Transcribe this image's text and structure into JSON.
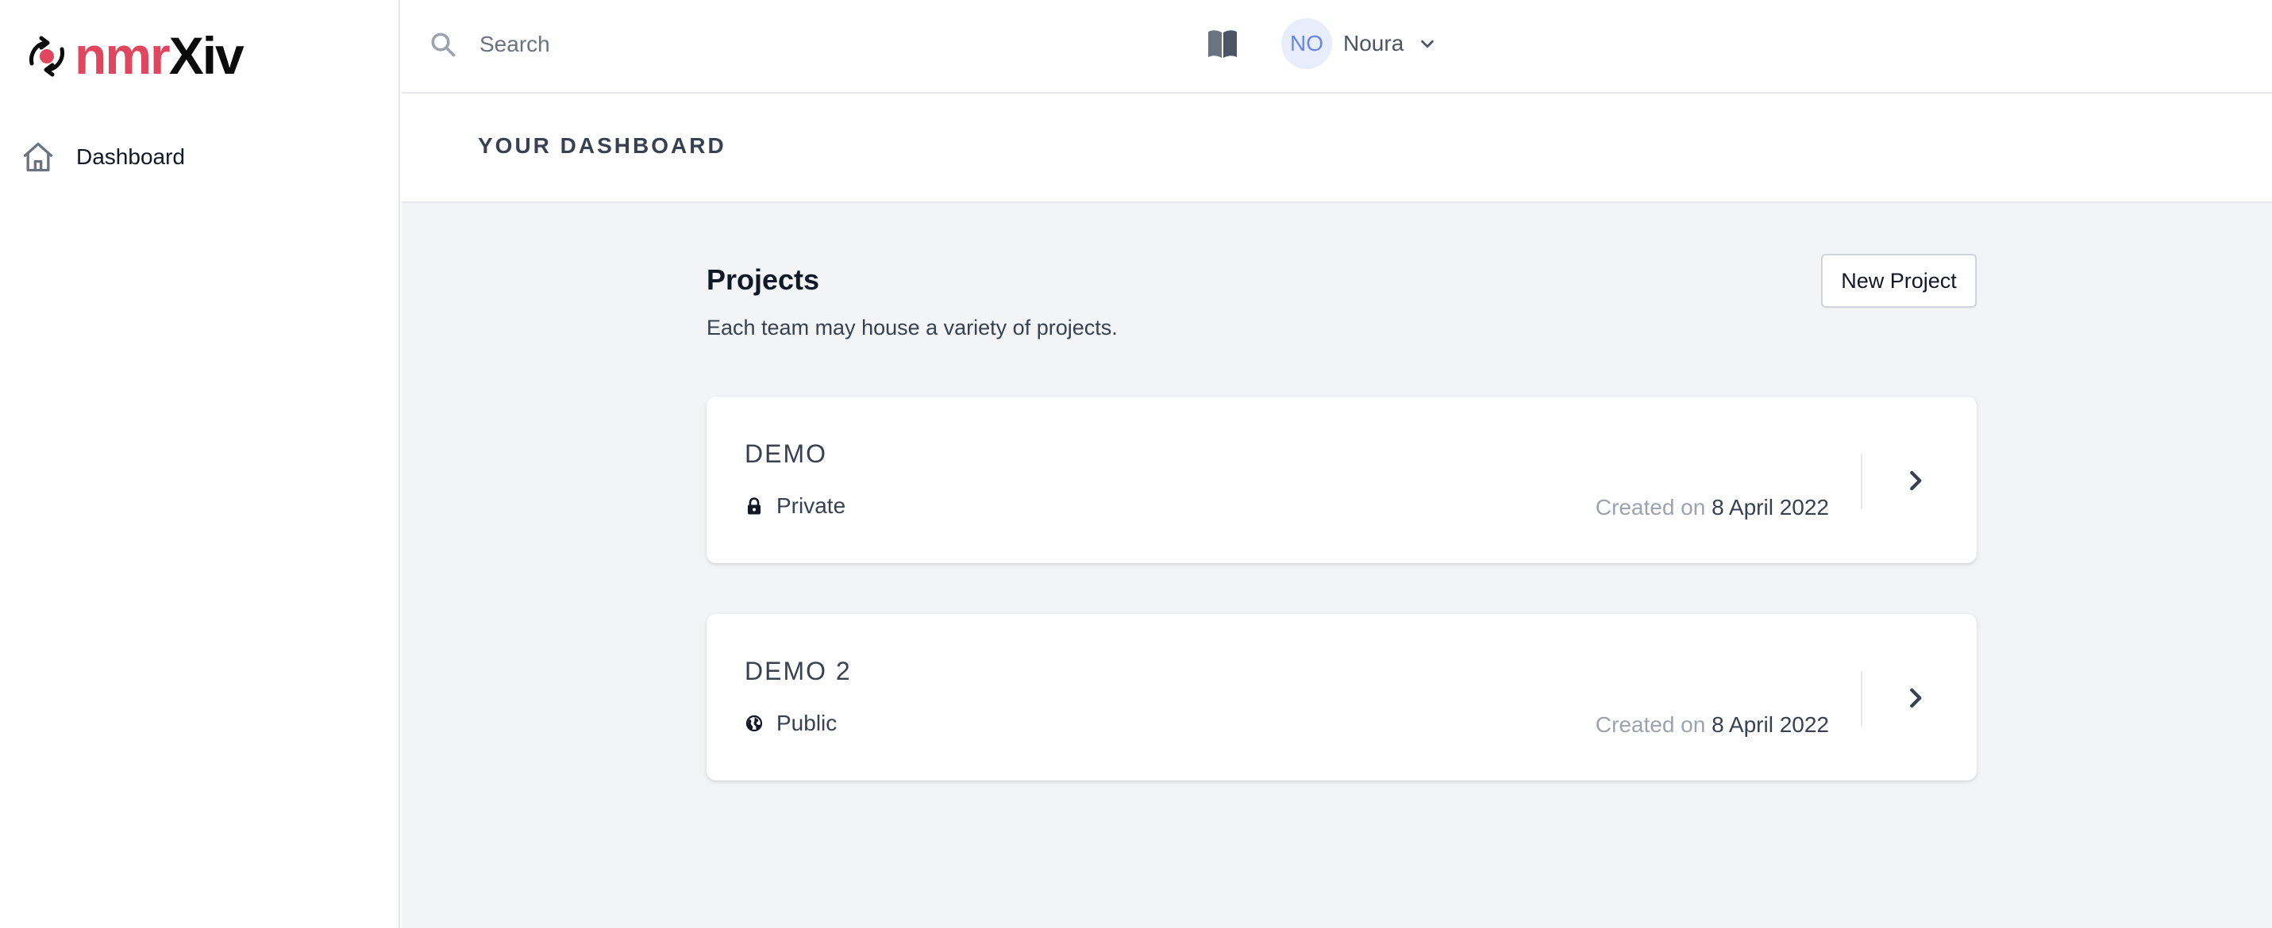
{
  "app": {
    "logo_text_part1": "nmr",
    "logo_text_part2": "Xiv"
  },
  "sidebar": {
    "items": [
      {
        "label": "Dashboard",
        "icon": "home-icon"
      }
    ]
  },
  "topbar": {
    "search_placeholder": "Search",
    "docs_icon": "book-icon",
    "user": {
      "initials": "NO",
      "name": "Noura"
    }
  },
  "page": {
    "title": "YOUR DASHBOARD"
  },
  "projects": {
    "title": "Projects",
    "description": "Each team may house a variety of projects.",
    "new_button": "New Project",
    "items": [
      {
        "name": "DEMO",
        "visibility": "Private",
        "visibility_icon": "lock-icon",
        "created_prefix": "Created on",
        "created_date": "8 April 2022"
      },
      {
        "name": "DEMO 2",
        "visibility": "Public",
        "visibility_icon": "globe-icon",
        "created_prefix": "Created on",
        "created_date": "8 April 2022"
      }
    ]
  },
  "colors": {
    "brand": "#e0465e",
    "avatar_bg": "#e8edfb",
    "avatar_text": "#6a86e8",
    "main_bg": "#f3f4f6"
  }
}
